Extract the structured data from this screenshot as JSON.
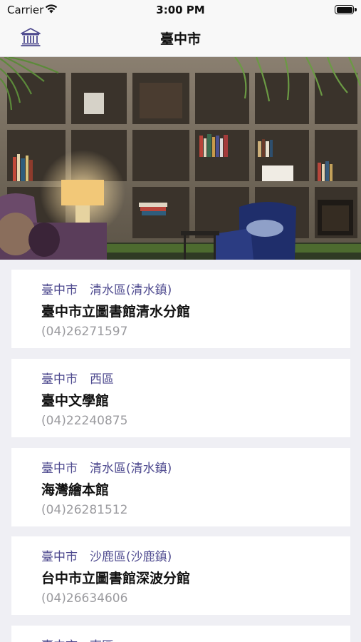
{
  "status_bar": {
    "carrier": "Carrier",
    "time": "3:00 PM"
  },
  "nav": {
    "title": "臺中市",
    "left_icon": "library-icon"
  },
  "hero": {
    "description_icon": "bookshelf-photo"
  },
  "libraries": [
    {
      "region": "臺中市　清水區(清水鎮)",
      "name": "臺中市立圖書館清水分館",
      "phone": "(04)26271597"
    },
    {
      "region": "臺中市　西區",
      "name": "臺中文學館",
      "phone": "(04)22240875"
    },
    {
      "region": "臺中市　清水區(清水鎮)",
      "name": "海灣繪本館",
      "phone": "(04)26281512"
    },
    {
      "region": "臺中市　沙鹿區(沙鹿鎮)",
      "name": "台中市立圖書館深波分館",
      "phone": "(04)26634606"
    },
    {
      "region": "臺中市　南區",
      "name": "",
      "phone": ""
    }
  ],
  "colors": {
    "region": "#4e4a8f",
    "phone": "#9b9b9f",
    "background": "#efeff4"
  }
}
